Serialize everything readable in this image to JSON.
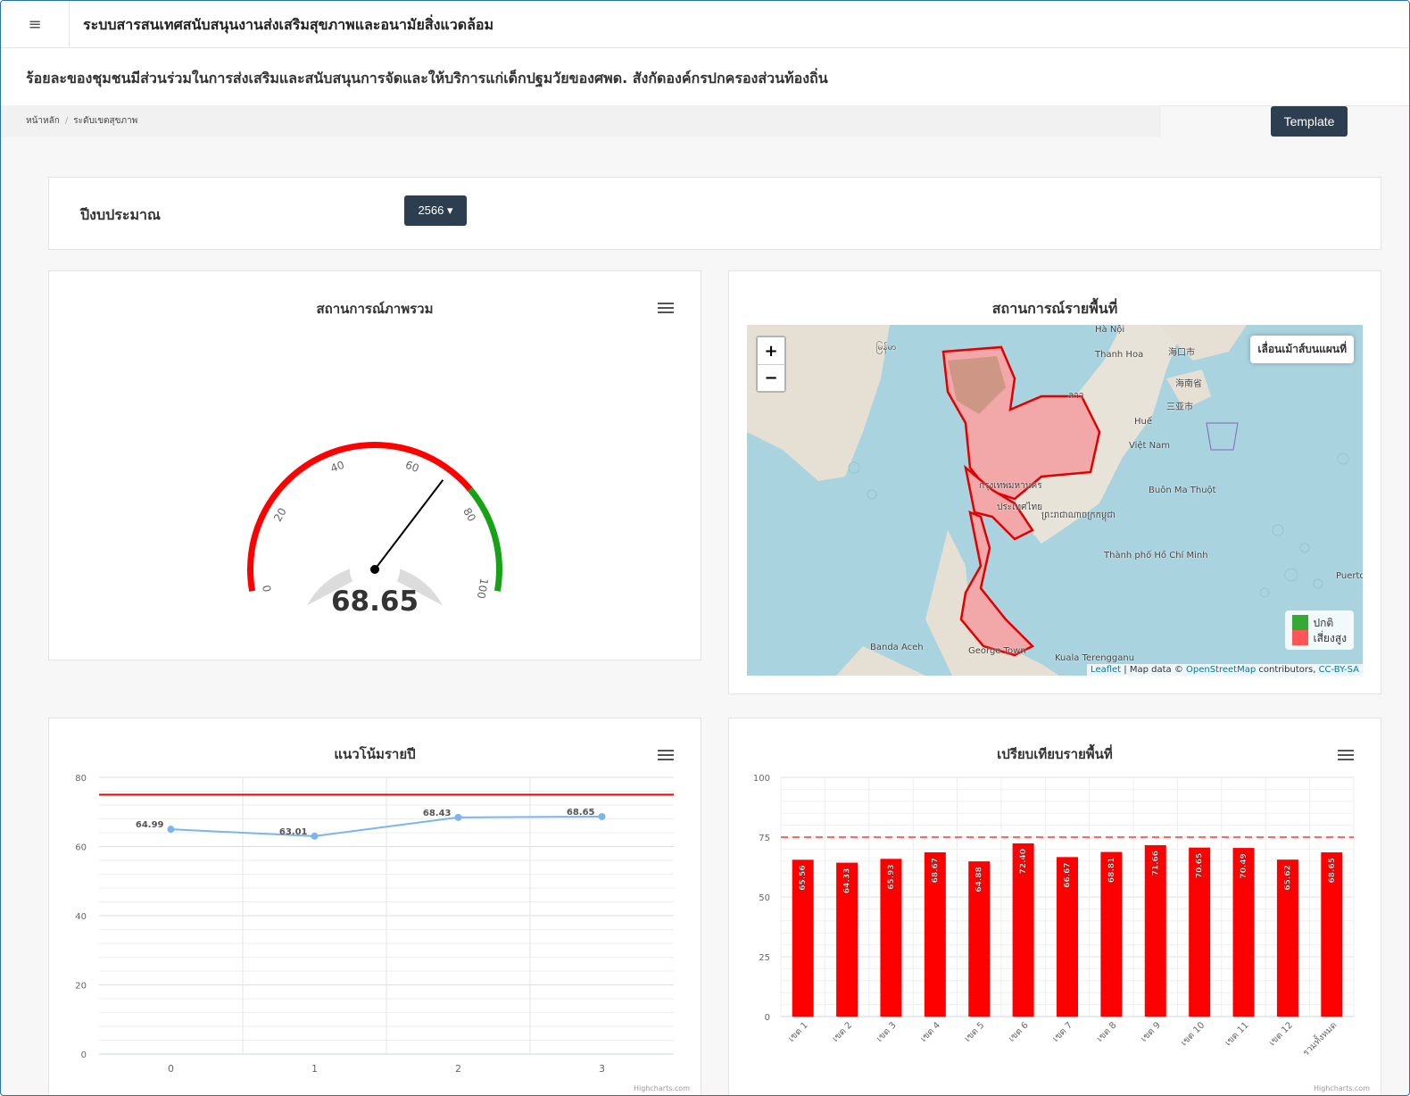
{
  "app": {
    "title": "ระบบสารสนเทศสนับสนุนงานส่งเสริมสุขภาพและอนามัยสิ่งแวดล้อม",
    "menu_icon": "hamburger-icon"
  },
  "page": {
    "heading": "ร้อยละของชุมชนมีส่วนร่วมในการส่งเสริมและสนับสนุนการจัดและให้บริการแก่เด็กปฐมวัยของศพด. สังกัดองค์กรปกครองส่วนท้องถิ่น"
  },
  "breadcrumb": {
    "home": "หน้าหลัก",
    "current": "ระดับเขตสุขภาพ"
  },
  "toolbar": {
    "template_label": "Template"
  },
  "filter": {
    "label": "ปีงบประมาณ",
    "year_value": "2566"
  },
  "gauge": {
    "title": "สถานการณ์ภาพรวม",
    "value": 68.65,
    "value_text": "68.65",
    "min": 0,
    "max": 100,
    "ticks": [
      "0",
      "20",
      "40",
      "60",
      "80",
      "100"
    ],
    "bands": [
      {
        "from": 0,
        "to": 75,
        "color": "#ff0000"
      },
      {
        "from": 75,
        "to": 100,
        "color": "#15a215"
      }
    ]
  },
  "map": {
    "title": "สถานการณ์รายพื้นที่",
    "hover_info": "เลื่อนเม้าส์บนแผนที่",
    "zoom_in": "+",
    "zoom_out": "−",
    "legend": [
      {
        "label": "ปกติ",
        "color": "#33aa33"
      },
      {
        "label": "เสี่ยงสูง",
        "color": "#ff5555"
      }
    ],
    "places": [
      "Thanh Hoa",
      "海口市",
      "Huế",
      "Việt Nam",
      "Buôn Ma Thuột",
      "Thành phố Hồ Chí Minh",
      "Banda Aceh",
      "George Town",
      "Kuala Terengganu",
      "Puerto",
      "ลาว",
      "กรุงเทพมหานคร",
      "ประเทศไทย",
      "ព្រះរាជាណាចក្រកម្ពុជា",
      "မြန်မာ",
      "海南省",
      "三亚市",
      "Hà Nội"
    ],
    "attribution_leaflet": "Leaflet",
    "attribution_text": " | Map data © ",
    "attribution_osm": "OpenStreetMap",
    "attribution_contrib": " contributors, ",
    "attribution_license": "CC-BY-SA"
  },
  "trend": {
    "title": "แนวโน้มรายปี",
    "credits": "Highcharts.com",
    "chart_data": {
      "type": "line",
      "x": [
        0,
        1,
        2,
        3
      ],
      "categories": [
        "0",
        "1",
        "2",
        "3"
      ],
      "values": [
        64.99,
        63.01,
        68.43,
        68.65
      ],
      "labels": [
        "64.99",
        "63.01",
        "68.43",
        "68.65"
      ],
      "ylim": [
        0,
        80
      ],
      "yticks": [
        "0",
        "20",
        "40",
        "60",
        "80"
      ],
      "target_line": 75,
      "series_color": "#7cb5ec",
      "target_color": "#ff0000",
      "grid": true
    }
  },
  "compare": {
    "title": "เปรียบเทียบรายพื้นที่",
    "credits": "Highcharts.com",
    "chart_data": {
      "type": "bar",
      "categories": [
        "เขต 1",
        "เขต 2",
        "เขต 3",
        "เขต 4",
        "เขต 5",
        "เขต 6",
        "เขต 7",
        "เขต 8",
        "เขต 9",
        "เขต 10",
        "เขต 11",
        "เขต 12",
        "รวมทั้งหมด"
      ],
      "values": [
        65.56,
        64.33,
        65.93,
        68.67,
        64.88,
        72.4,
        66.67,
        68.81,
        71.66,
        70.65,
        70.49,
        65.62,
        68.65
      ],
      "labels": [
        "65.56",
        "64.33",
        "65.93",
        "68.67",
        "64.88",
        "72.40",
        "66.67",
        "68.81",
        "71.66",
        "70.65",
        "70.49",
        "65.62",
        "68.65"
      ],
      "ylim": [
        0,
        100
      ],
      "yticks": [
        "0",
        "25",
        "50",
        "75",
        "100"
      ],
      "target_line": 75,
      "bar_color": "#ff0000",
      "grid": true
    }
  }
}
